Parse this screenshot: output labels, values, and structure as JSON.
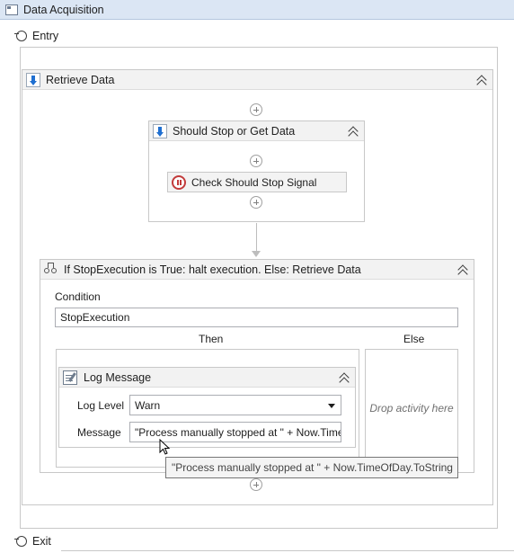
{
  "window": {
    "title": "Data Acquisition"
  },
  "state": {
    "entry_label": "Entry",
    "exit_label": "Exit"
  },
  "retrieve_data": {
    "title": "Retrieve Data"
  },
  "should_stop": {
    "title": "Should Stop or Get Data",
    "activity_label": "Check Should Stop Signal"
  },
  "if_block": {
    "title": "If StopExecution is True: halt execution. Else: Retrieve Data",
    "condition_label": "Condition",
    "condition_value": "StopExecution",
    "then_label": "Then",
    "else_label": "Else",
    "else_placeholder": "Drop activity here"
  },
  "log_message": {
    "title": "Log Message",
    "level_label": "Log Level",
    "level_value": "Warn",
    "message_label": "Message",
    "message_value": "\"Process manually stopped at \" + Now.Time"
  },
  "tooltip": {
    "text": "\"Process manually stopped at \" + Now.TimeOfDay.ToString"
  }
}
